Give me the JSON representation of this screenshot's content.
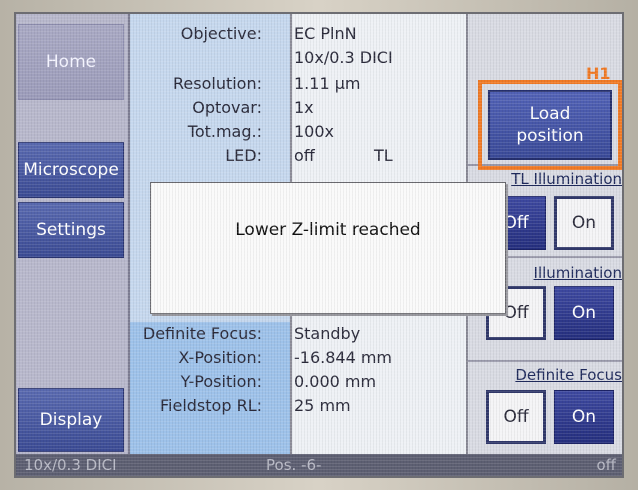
{
  "nav": {
    "home": "Home",
    "microscope": "Microscope",
    "settings": "Settings",
    "display": "Display"
  },
  "info_top": [
    {
      "label": "Objective:",
      "value": "EC PlnN"
    },
    {
      "label": "",
      "value": "10x/0.3 DICI"
    },
    {
      "label": "Resolution:",
      "value": "1.11 μm"
    },
    {
      "label": "Optovar:",
      "value": "1x"
    },
    {
      "label": "Tot.mag.:",
      "value": "100x"
    },
    {
      "label": "LED:",
      "value": "off",
      "extra": "TL"
    }
  ],
  "info_bottom": [
    {
      "label": "Definite Focus:",
      "value": "Standby"
    },
    {
      "label": "X-Position:",
      "value": "-16.844 mm"
    },
    {
      "label": "Y-Position:",
      "value": "0.000 mm"
    },
    {
      "label": "Fieldstop RL:",
      "value": "25 mm"
    }
  ],
  "right_panel": {
    "load_label": "Load position",
    "tl_title": "TL Illumination",
    "rl_title": "Illumination",
    "df_title": "Definite Focus",
    "off": "Off",
    "on": "On"
  },
  "annotation": {
    "tag": "H1",
    "color": "#f07a26"
  },
  "dialog": {
    "message": "Lower Z-limit reached"
  },
  "status": {
    "objective": "10x/0.3 DICI",
    "position": "Pos. -6-",
    "state": "off"
  }
}
